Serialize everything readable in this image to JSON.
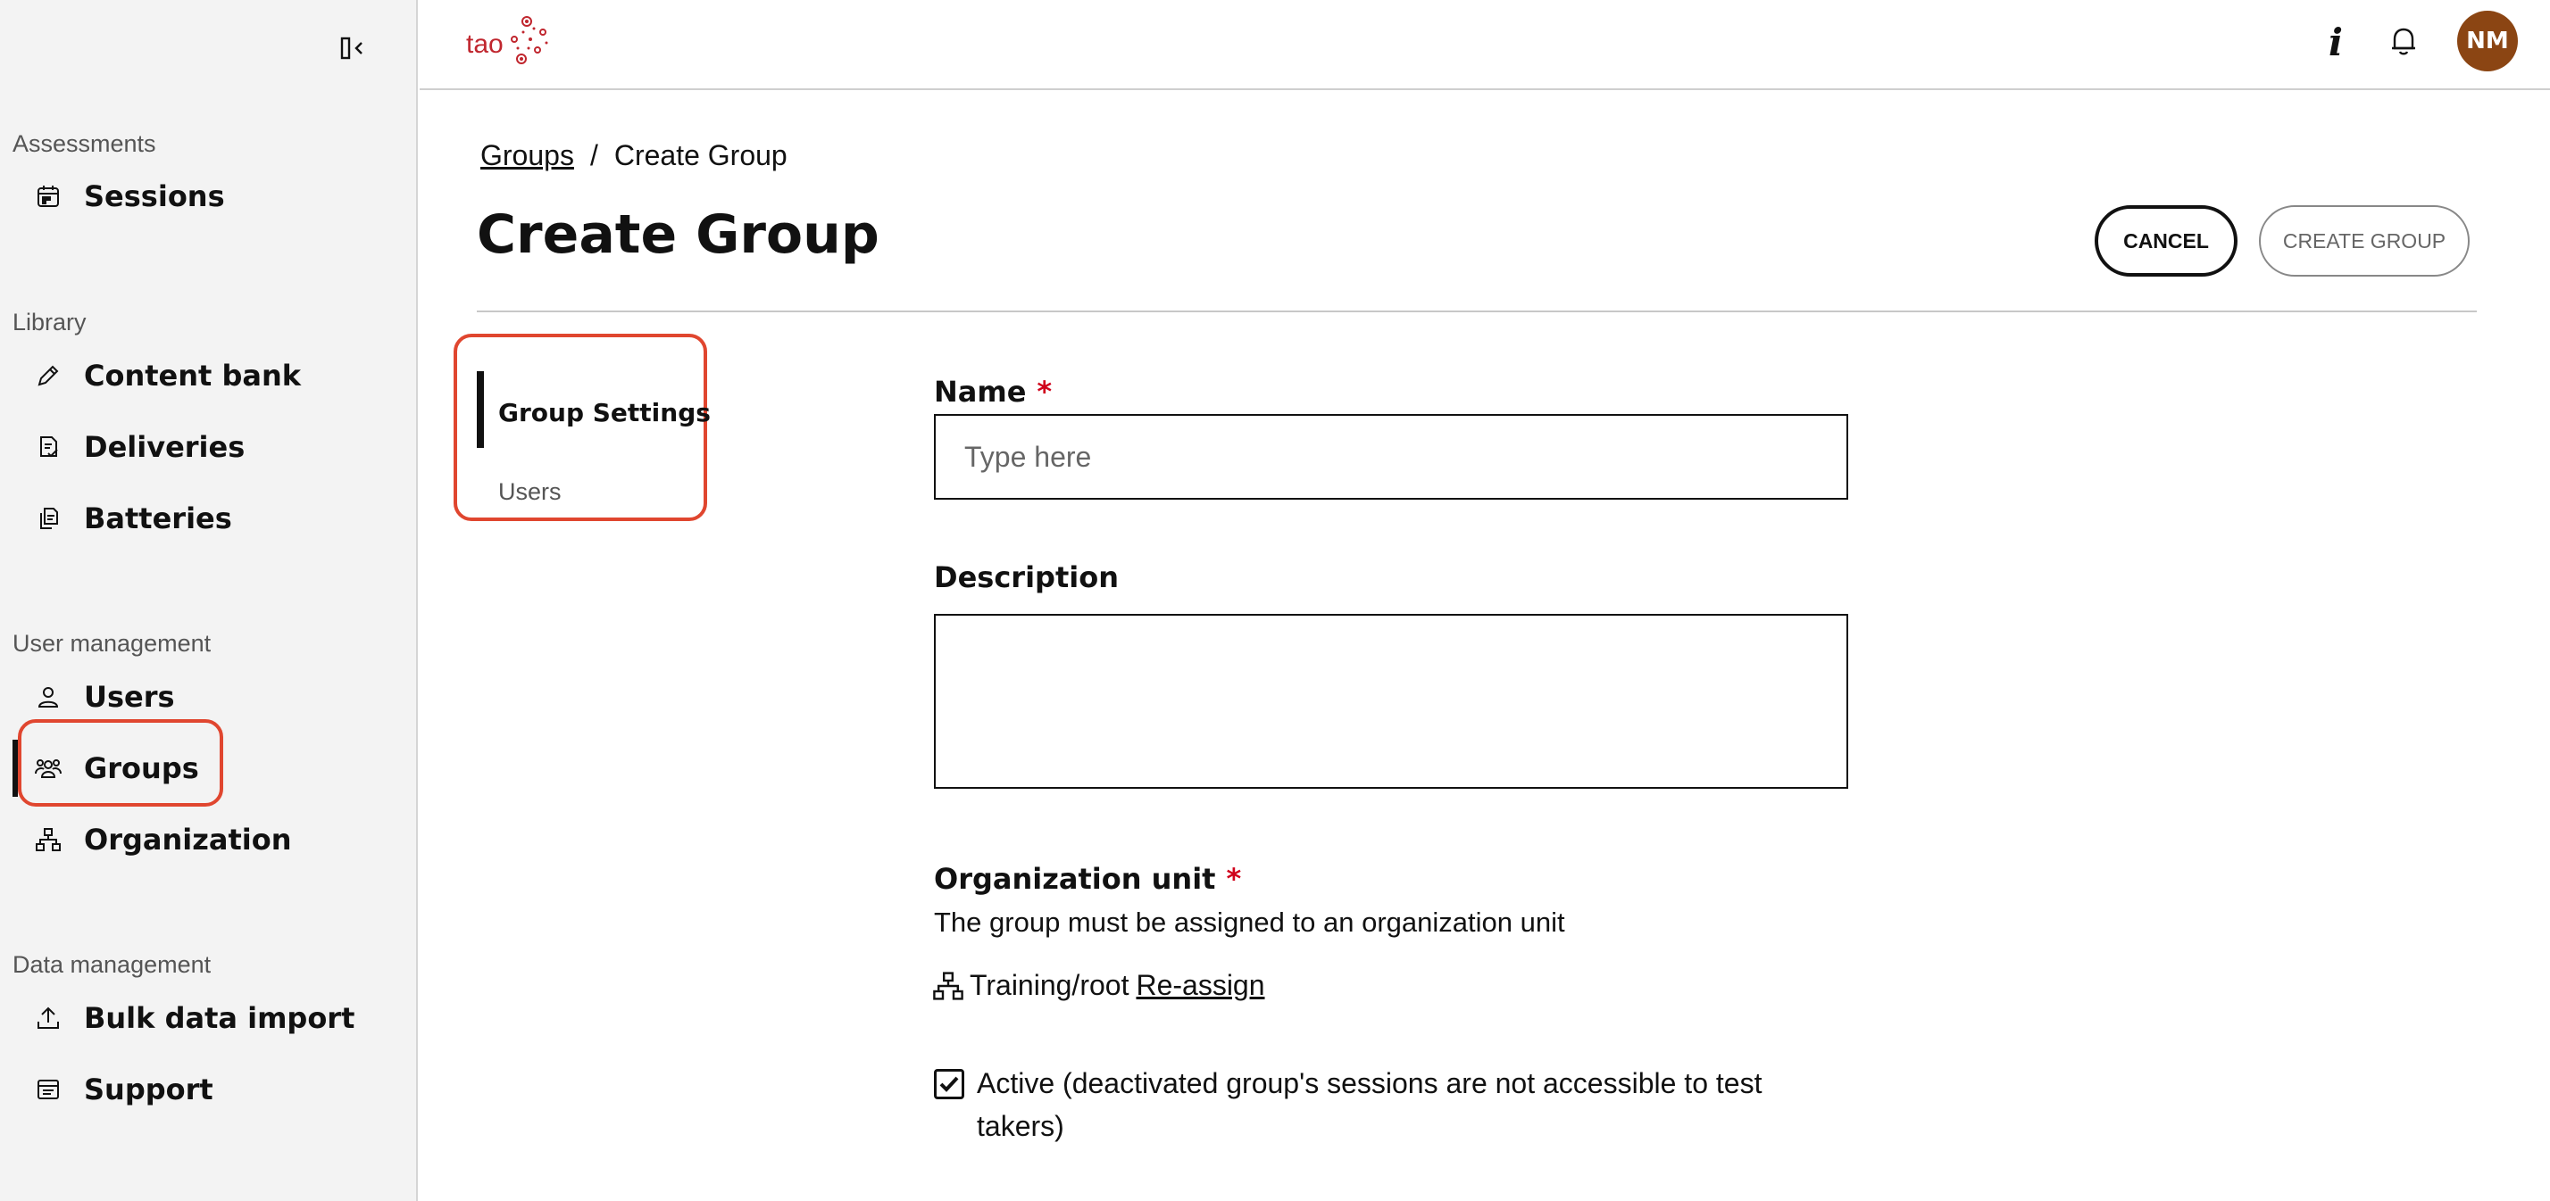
{
  "sidebar": {
    "sections": [
      {
        "label": "Assessments"
      },
      {
        "label": "Library"
      },
      {
        "label": "User management"
      },
      {
        "label": "Data management"
      }
    ],
    "items": [
      {
        "label": "Sessions",
        "icon": "calendar-icon"
      },
      {
        "label": "Content bank",
        "icon": "pencil-icon"
      },
      {
        "label": "Deliveries",
        "icon": "document-check-icon"
      },
      {
        "label": "Batteries",
        "icon": "documents-icon"
      },
      {
        "label": "Users",
        "icon": "user-icon"
      },
      {
        "label": "Groups",
        "icon": "group-icon",
        "active": true
      },
      {
        "label": "Organization",
        "icon": "hierarchy-icon"
      },
      {
        "label": "Bulk data import",
        "icon": "upload-icon"
      },
      {
        "label": "Support",
        "icon": "support-icon"
      }
    ]
  },
  "header": {
    "logo_text": "tao",
    "avatar_initials": "NM"
  },
  "breadcrumb": {
    "parent": "Groups",
    "separator": "/",
    "current": "Create Group"
  },
  "page": {
    "title": "Create Group",
    "cancel_label": "CANCEL",
    "create_label": "CREATE GROUP"
  },
  "subtabs": {
    "settings": "Group Settings",
    "users": "Users"
  },
  "form": {
    "name_label": "Name",
    "required_mark": "*",
    "name_placeholder": "Type here",
    "name_value": "",
    "description_label": "Description",
    "description_value": "",
    "org_label": "Organization unit",
    "org_help": "The group must be assigned to an organization unit",
    "org_value": "Training/root",
    "org_reassign": "Re-assign",
    "active_label": "Active (deactivated group's sessions are not accessible to test takers)",
    "active_checked": true
  },
  "colors": {
    "accent": "#e0462f",
    "avatar": "#8b4513",
    "logo": "#c0262e"
  }
}
